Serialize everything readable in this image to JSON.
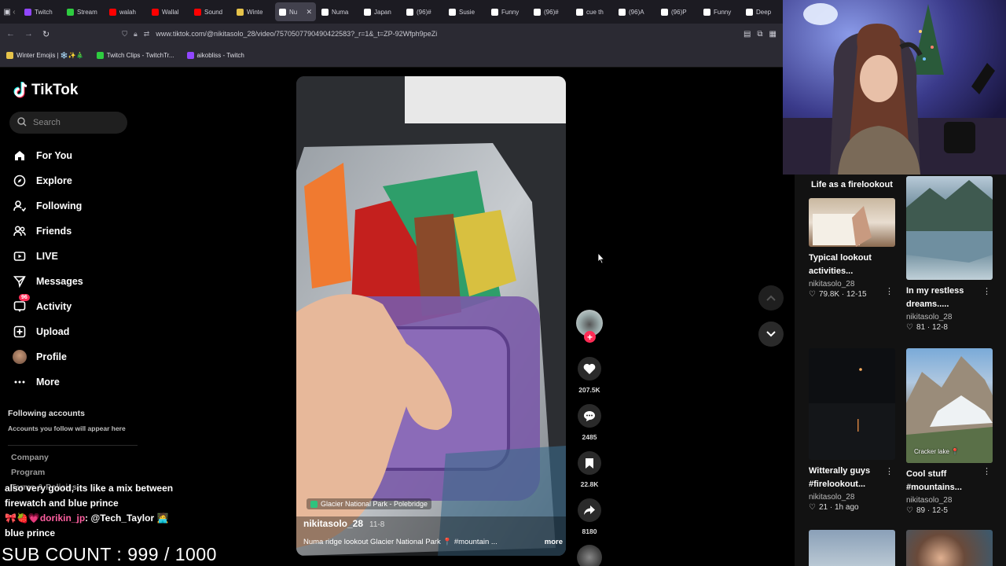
{
  "browser": {
    "tabs": [
      {
        "label": "Twitch",
        "color": "#9146ff"
      },
      {
        "label": "Stream",
        "color": "#2ecc40"
      },
      {
        "label": "walah",
        "color": "#ff0000"
      },
      {
        "label": "Wallal",
        "color": "#ff0000"
      },
      {
        "label": "Sound",
        "color": "#ff0000"
      },
      {
        "label": "Winte",
        "color": "#e6c34a"
      },
      {
        "label": "Nu",
        "color": "#ffffff",
        "active": true
      },
      {
        "label": "Numa",
        "color": "#ffffff"
      },
      {
        "label": "Japan",
        "color": "#ffffff"
      },
      {
        "label": "(96)#",
        "color": "#ffffff"
      },
      {
        "label": "Susie",
        "color": "#ffffff"
      },
      {
        "label": "Funny",
        "color": "#ffffff"
      },
      {
        "label": "(96)#",
        "color": "#ffffff"
      },
      {
        "label": "cue th",
        "color": "#ffffff"
      },
      {
        "label": "(96)A",
        "color": "#ffffff"
      },
      {
        "label": "(96)P",
        "color": "#ffffff"
      },
      {
        "label": "Funny",
        "color": "#ffffff"
      },
      {
        "label": "Deep",
        "color": "#ffffff"
      }
    ],
    "close_glyph": "✕",
    "url": "www.tiktok.com/@nikitasolo_28/video/7570507790490422583?_r=1&_t=ZP-92Wfph9peZi",
    "bookmarks": [
      {
        "label": "Winter Emojis | ❄️✨🎄",
        "color": "#e6c34a"
      },
      {
        "label": "Twitch Clips - TwitchTr...",
        "color": "#2ecc40"
      },
      {
        "label": "aikobliss - Twitch",
        "color": "#9146ff"
      }
    ]
  },
  "tiktok": {
    "logo": "TikTok",
    "search_placeholder": "Search",
    "nav": [
      {
        "label": "For You",
        "icon": "home-icon"
      },
      {
        "label": "Explore",
        "icon": "compass-icon"
      },
      {
        "label": "Following",
        "icon": "following-icon"
      },
      {
        "label": "Friends",
        "icon": "friends-icon"
      },
      {
        "label": "LIVE",
        "icon": "live-icon"
      },
      {
        "label": "Messages",
        "icon": "messages-icon"
      },
      {
        "label": "Activity",
        "icon": "activity-icon",
        "badge": "96"
      },
      {
        "label": "Upload",
        "icon": "upload-icon"
      },
      {
        "label": "Profile",
        "icon": "profile-avatar"
      },
      {
        "label": "More",
        "icon": "more-icon"
      }
    ],
    "following_heading": "Following accounts",
    "following_sub": "Accounts you follow will appear here",
    "footer_links": [
      "Company",
      "Program",
      "Terms & Policies"
    ],
    "video": {
      "location": "Glacier National Park - Polebridge",
      "username": "nikitasolo_28",
      "date": "11-8",
      "caption": "Numa ridge lookout Glacier National Park 📍 #mountain ...",
      "more": "more"
    },
    "actions": {
      "likes": "207.5K",
      "comments": "2485",
      "saves": "22.8K",
      "shares": "8180",
      "follow_plus": "+"
    },
    "panel": {
      "title": "Life as a firelookout",
      "cards": [
        {
          "title": "Typical lookout activities...",
          "author": "nikitasolo_28",
          "stats": "79.8K · 12-15"
        },
        {
          "title": "In my restless dreams.....",
          "author": "nikitasolo_28",
          "stats": "81 · 12-8"
        },
        {
          "title": "Witterally guys #firelookout...",
          "author": "nikitasolo_28",
          "stats": "21 · 1h ago"
        },
        {
          "title": "Cool stuff #mountains...",
          "author": "nikitasolo_28",
          "stats": "89 · 12-5",
          "thumb_label": "Cracker lake 📍"
        }
      ]
    }
  },
  "stream_overlay": {
    "chat_lines": [
      {
        "user": "",
        "text": "also very good, its like a mix between"
      },
      {
        "user": "",
        "text": "firewatch and blue prince"
      },
      {
        "user": "dorikin_jp",
        "text": ": @Tech_Taylor"
      },
      {
        "user": "",
        "text": "blue prince"
      }
    ],
    "chat_user_prefix": "🎀🍓💗",
    "chat_user_suffix": "🧑‍💻",
    "sub_count": "SUB COUNT : 999 / 1000"
  }
}
